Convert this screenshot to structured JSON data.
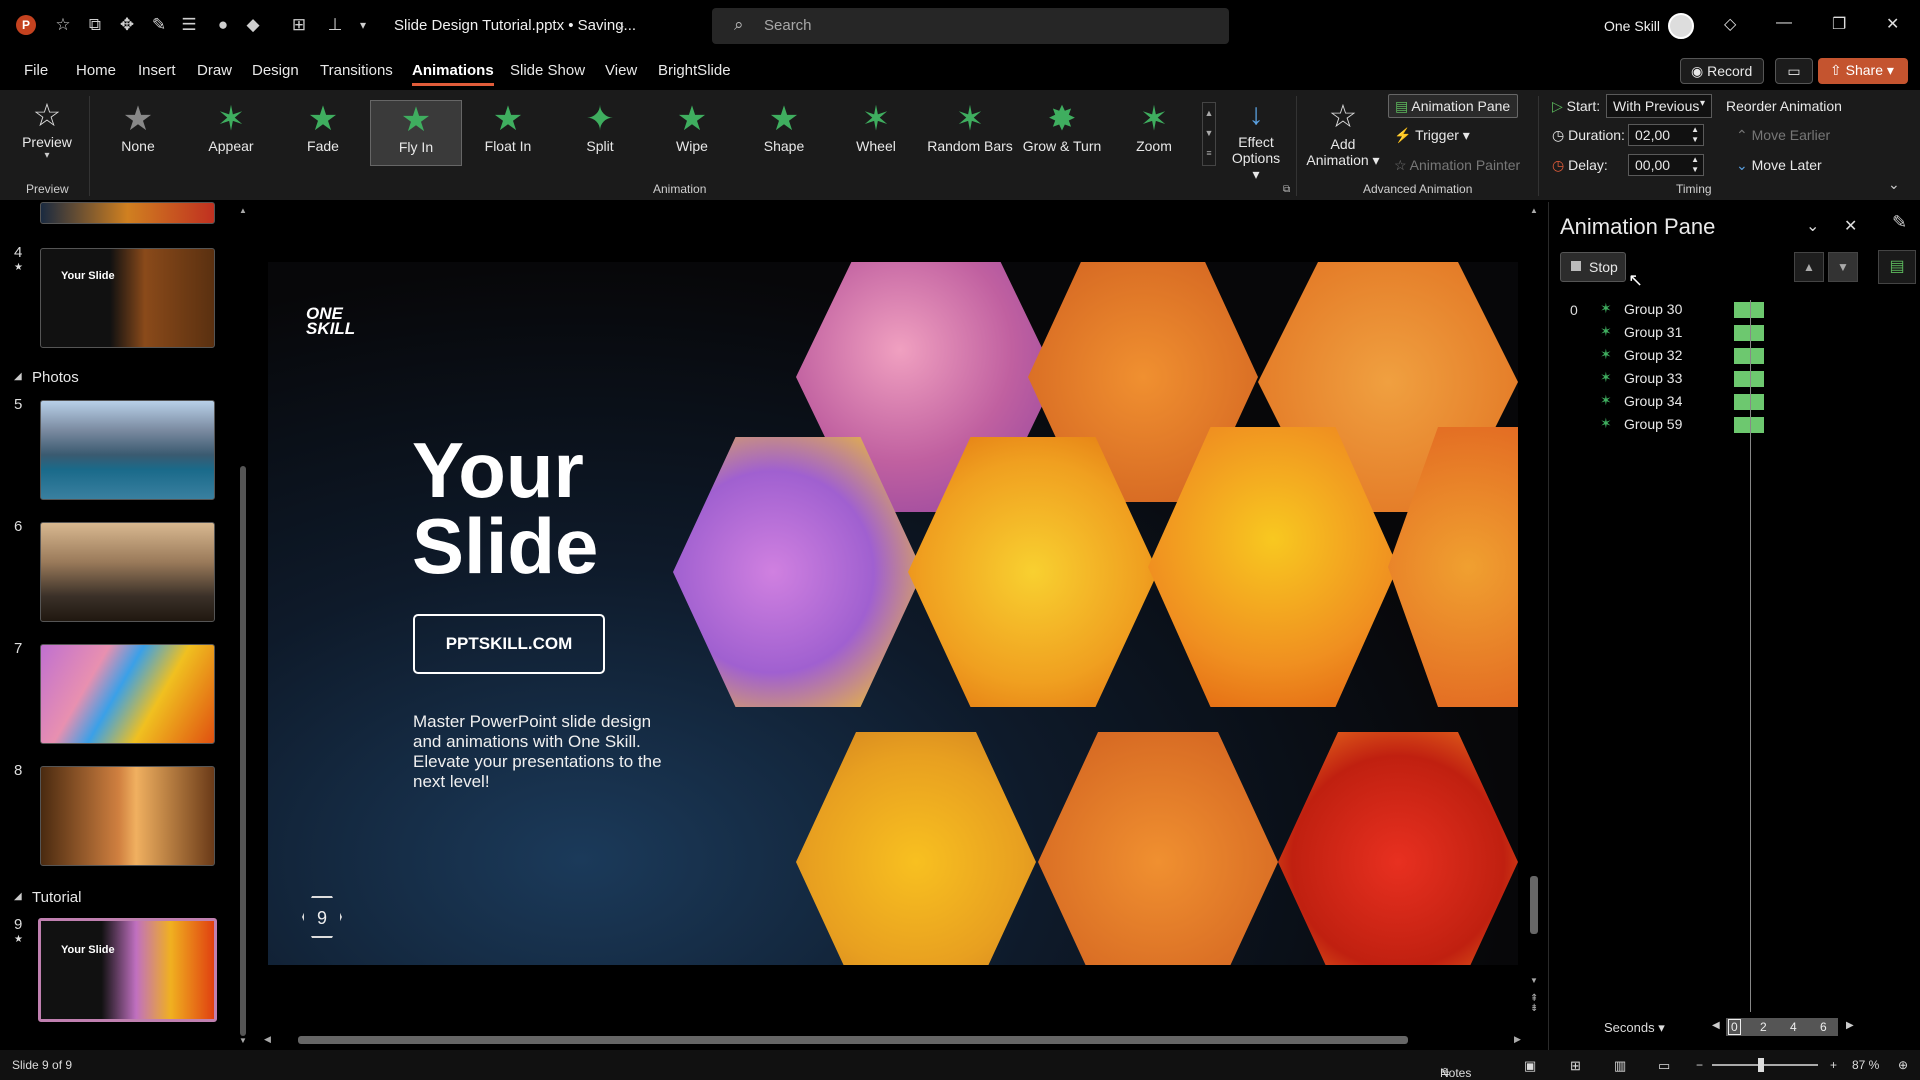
{
  "window": {
    "doc_title": "Slide Design Tutorial.pptx • Saving...",
    "search_placeholder": "Search",
    "account_name": "One Skill"
  },
  "menu": {
    "tabs": [
      "File",
      "Home",
      "Insert",
      "Draw",
      "Design",
      "Transitions",
      "Animations",
      "Slide Show",
      "View",
      "BrightSlide"
    ],
    "active_tab": "Animations",
    "record_label": "Record",
    "share_label": "Share"
  },
  "ribbon": {
    "preview_label": "Preview",
    "preview_group": "Preview",
    "animation_group": "Animation",
    "animations": [
      "None",
      "Appear",
      "Fade",
      "Fly In",
      "Float In",
      "Split",
      "Wipe",
      "Shape",
      "Wheel",
      "Random Bars",
      "Grow & Turn",
      "Zoom"
    ],
    "selected_animation": "Fly In",
    "effect_options_1": "Effect",
    "effect_options_2": "Options",
    "add_animation_1": "Add",
    "add_animation_2": "Animation",
    "animation_pane_btn": "Animation Pane",
    "trigger": "Trigger",
    "animation_painter": "Animation Painter",
    "advanced_group": "Advanced Animation",
    "start_label": "Start:",
    "start_value": "With Previous",
    "duration_label": "Duration:",
    "duration_value": "02,00",
    "delay_label": "Delay:",
    "delay_value": "00,00",
    "reorder_label": "Reorder Animation",
    "move_earlier": "Move Earlier",
    "move_later": "Move Later",
    "timing_group": "Timing"
  },
  "thumbnails": {
    "sections": [
      "Photos",
      "Tutorial"
    ],
    "slide_numbers": [
      "4",
      "5",
      "6",
      "7",
      "8",
      "9"
    ],
    "thumb_text": "Your Slide"
  },
  "slide": {
    "logo_line1": "ONE",
    "logo_line2": "SKILL",
    "title_line1": "Your",
    "title_line2": "Slide",
    "button": "PPTSKILL.COM",
    "body": "Master PowerPoint slide design and animations with One Skill. Elevate your presentations to the next level!",
    "number": "9"
  },
  "animation_pane": {
    "title": "Animation Pane",
    "stop_label": "Stop",
    "index_label": "0",
    "items": [
      "Group 30",
      "Group 31",
      "Group 32",
      "Group 33",
      "Group 34",
      "Group 59"
    ],
    "seconds_label": "Seconds",
    "timeline_ticks": [
      "0",
      "2",
      "4",
      "6"
    ]
  },
  "status": {
    "slide_info": "Slide 9 of 9",
    "notes_label": "Notes",
    "zoom": "87 %"
  },
  "colors": {
    "accent": "#e05c3a",
    "anim_star": "#3fae5f",
    "anim_bar": "#6dc86f",
    "share": "#c4542f"
  }
}
